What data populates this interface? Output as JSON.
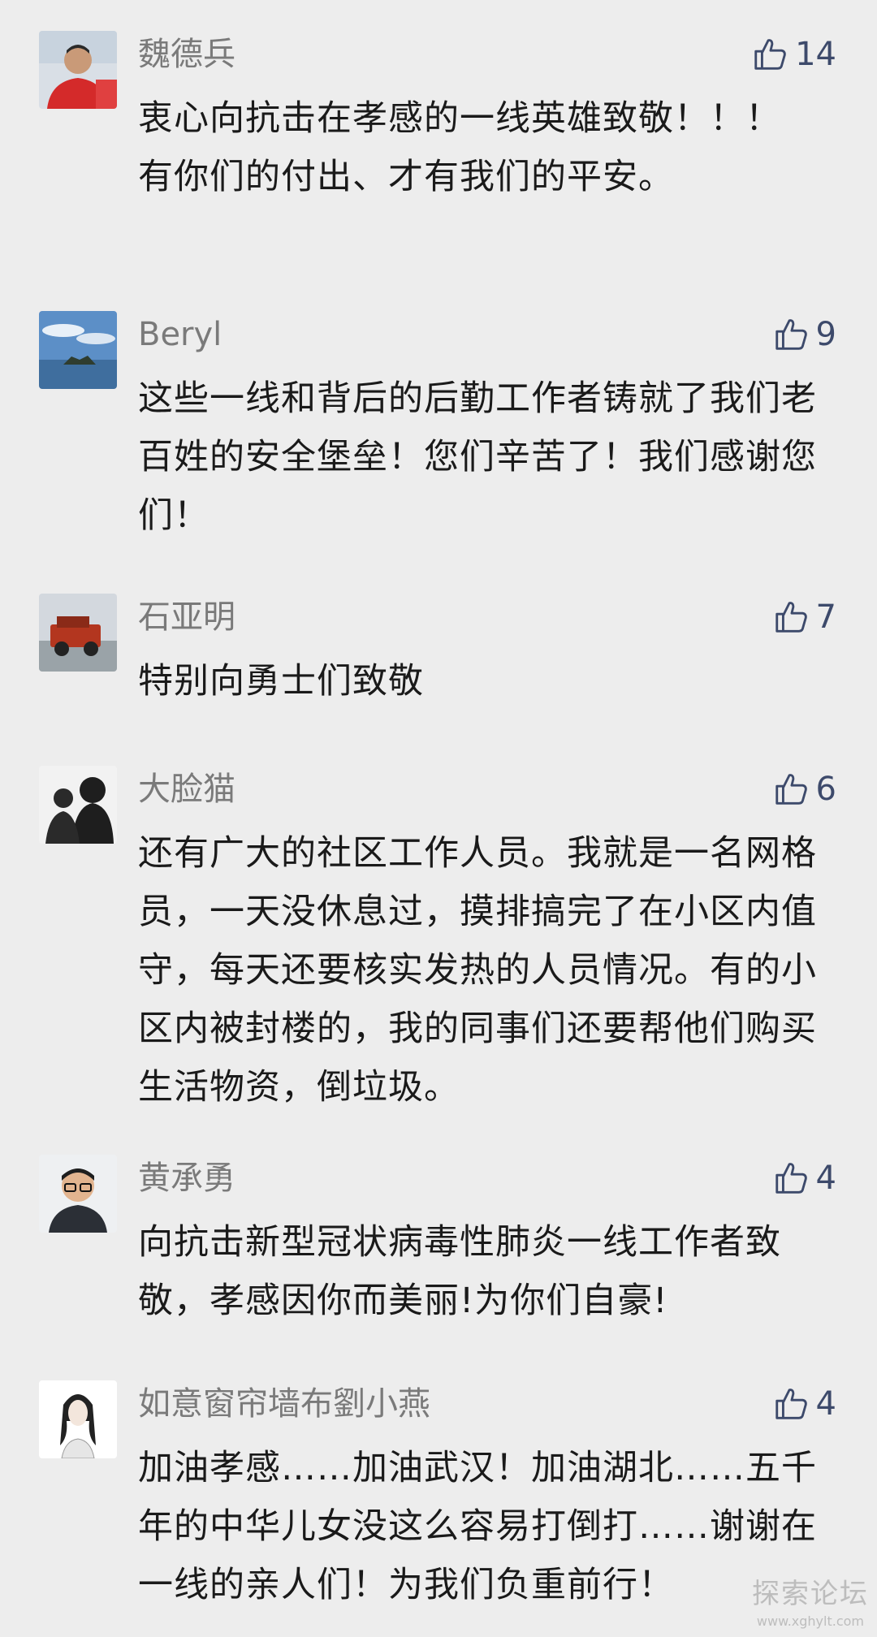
{
  "comments": [
    {
      "name": "魏德兵",
      "likes": "14",
      "text": "衷心向抗击在孝感的一线英雄致敬！！！　　　有你们的付出、才有我们的平安。",
      "avatar": "man-red-shirt-avatar"
    },
    {
      "name": "Beryl",
      "likes": "9",
      "text": "这些一线和背后的后勤工作者铸就了我们老百姓的安全堡垒！您们辛苦了！我们感谢您们！",
      "avatar": "sky-island-avatar"
    },
    {
      "name": "石亚明",
      "likes": "7",
      "text": "特别向勇士们致敬",
      "avatar": "jeep-avatar"
    },
    {
      "name": "大脸猫",
      "likes": "6",
      "text": "还有广大的社区工作人员。我就是一名网格员，一天没休息过，摸排搞完了在小区内值守，每天还要核实发热的人员情况。有的小区内被封楼的，我的同事们还要帮他们购买生活物资，倒垃圾。",
      "avatar": "mother-child-avatar"
    },
    {
      "name": "黄承勇",
      "likes": "4",
      "text": "向抗击新型冠状病毒性肺炎一线工作者致敬，孝感因你而美丽!为你们自豪!",
      "avatar": "man-glasses-avatar"
    },
    {
      "name": "如意窗帘墙布劉小燕",
      "likes": "4",
      "text": "加油孝感……加油武汉！加油湖北……五千年的中华儿女没这么容易打倒打……谢谢在一线的亲人们！为我们负重前行！",
      "avatar": "woman-sketch-avatar"
    }
  ],
  "watermark": {
    "text": "探索论坛",
    "url": "www.xghylt.com"
  }
}
